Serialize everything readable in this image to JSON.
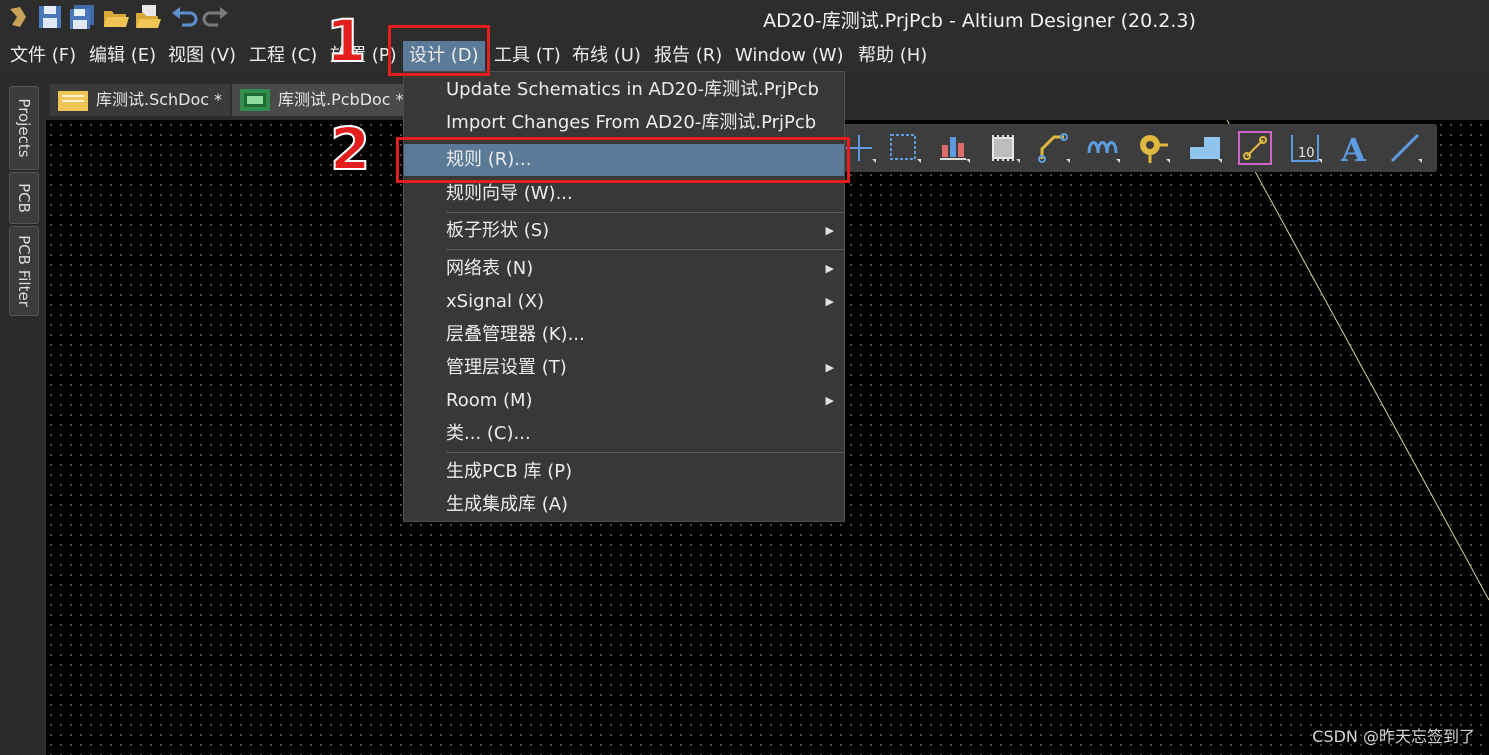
{
  "window": {
    "title": "AD20-库测试.PrjPcb - Altium Designer (20.2.3)"
  },
  "menu": {
    "items": [
      "文件 (F)",
      "编辑 (E)",
      "视图 (V)",
      "工程 (C)",
      "放置 (P)",
      "设计 (D)",
      "工具 (T)",
      "布线 (U)",
      "报告 (R)",
      "Window (W)",
      "帮助 (H)"
    ],
    "active_index": 5
  },
  "tabs": [
    {
      "label": "库测试.SchDoc *",
      "icon": "schematic-doc-icon"
    },
    {
      "label": "库测试.PcbDoc *",
      "icon": "pcb-doc-icon"
    }
  ],
  "side_panels": [
    "Projects",
    "PCB",
    "PCB Filter"
  ],
  "dropdown": {
    "items": [
      {
        "label": "Update Schematics in AD20-库测试.PrjPcb",
        "submenu": false
      },
      {
        "label": "Import Changes From AD20-库测试.PrjPcb",
        "submenu": false
      },
      {
        "label": "规则 (R)...",
        "submenu": false,
        "highlighted": true
      },
      {
        "label": "规则向导 (W)...",
        "submenu": false
      },
      {
        "label": "板子形状 (S)",
        "submenu": true
      },
      {
        "label": "网络表 (N)",
        "submenu": true
      },
      {
        "label": "xSignal (X)",
        "submenu": true
      },
      {
        "label": "层叠管理器 (K)...",
        "submenu": false
      },
      {
        "label": "管理层设置 (T)",
        "submenu": true
      },
      {
        "label": "Room (M)",
        "submenu": true
      },
      {
        "label": "类... (C)...",
        "submenu": false
      },
      {
        "label": "生成PCB 库 (P)",
        "submenu": false
      },
      {
        "label": "生成集成库 (A)",
        "submenu": false
      }
    ]
  },
  "toolbar_icons": [
    "move-icon",
    "select-rect-icon",
    "align-icon",
    "component-icon",
    "route-icon",
    "diff-pair-icon",
    "via-icon",
    "polygon-icon",
    "interactive-route-icon",
    "dimension-icon",
    "text-icon",
    "line-icon"
  ],
  "annotations": {
    "step1": "1",
    "step2": "2"
  },
  "watermark": "CSDN @昨天忘签到了",
  "colors": {
    "highlight": "#5b7a98",
    "annotation_red": "#e41d1d"
  }
}
